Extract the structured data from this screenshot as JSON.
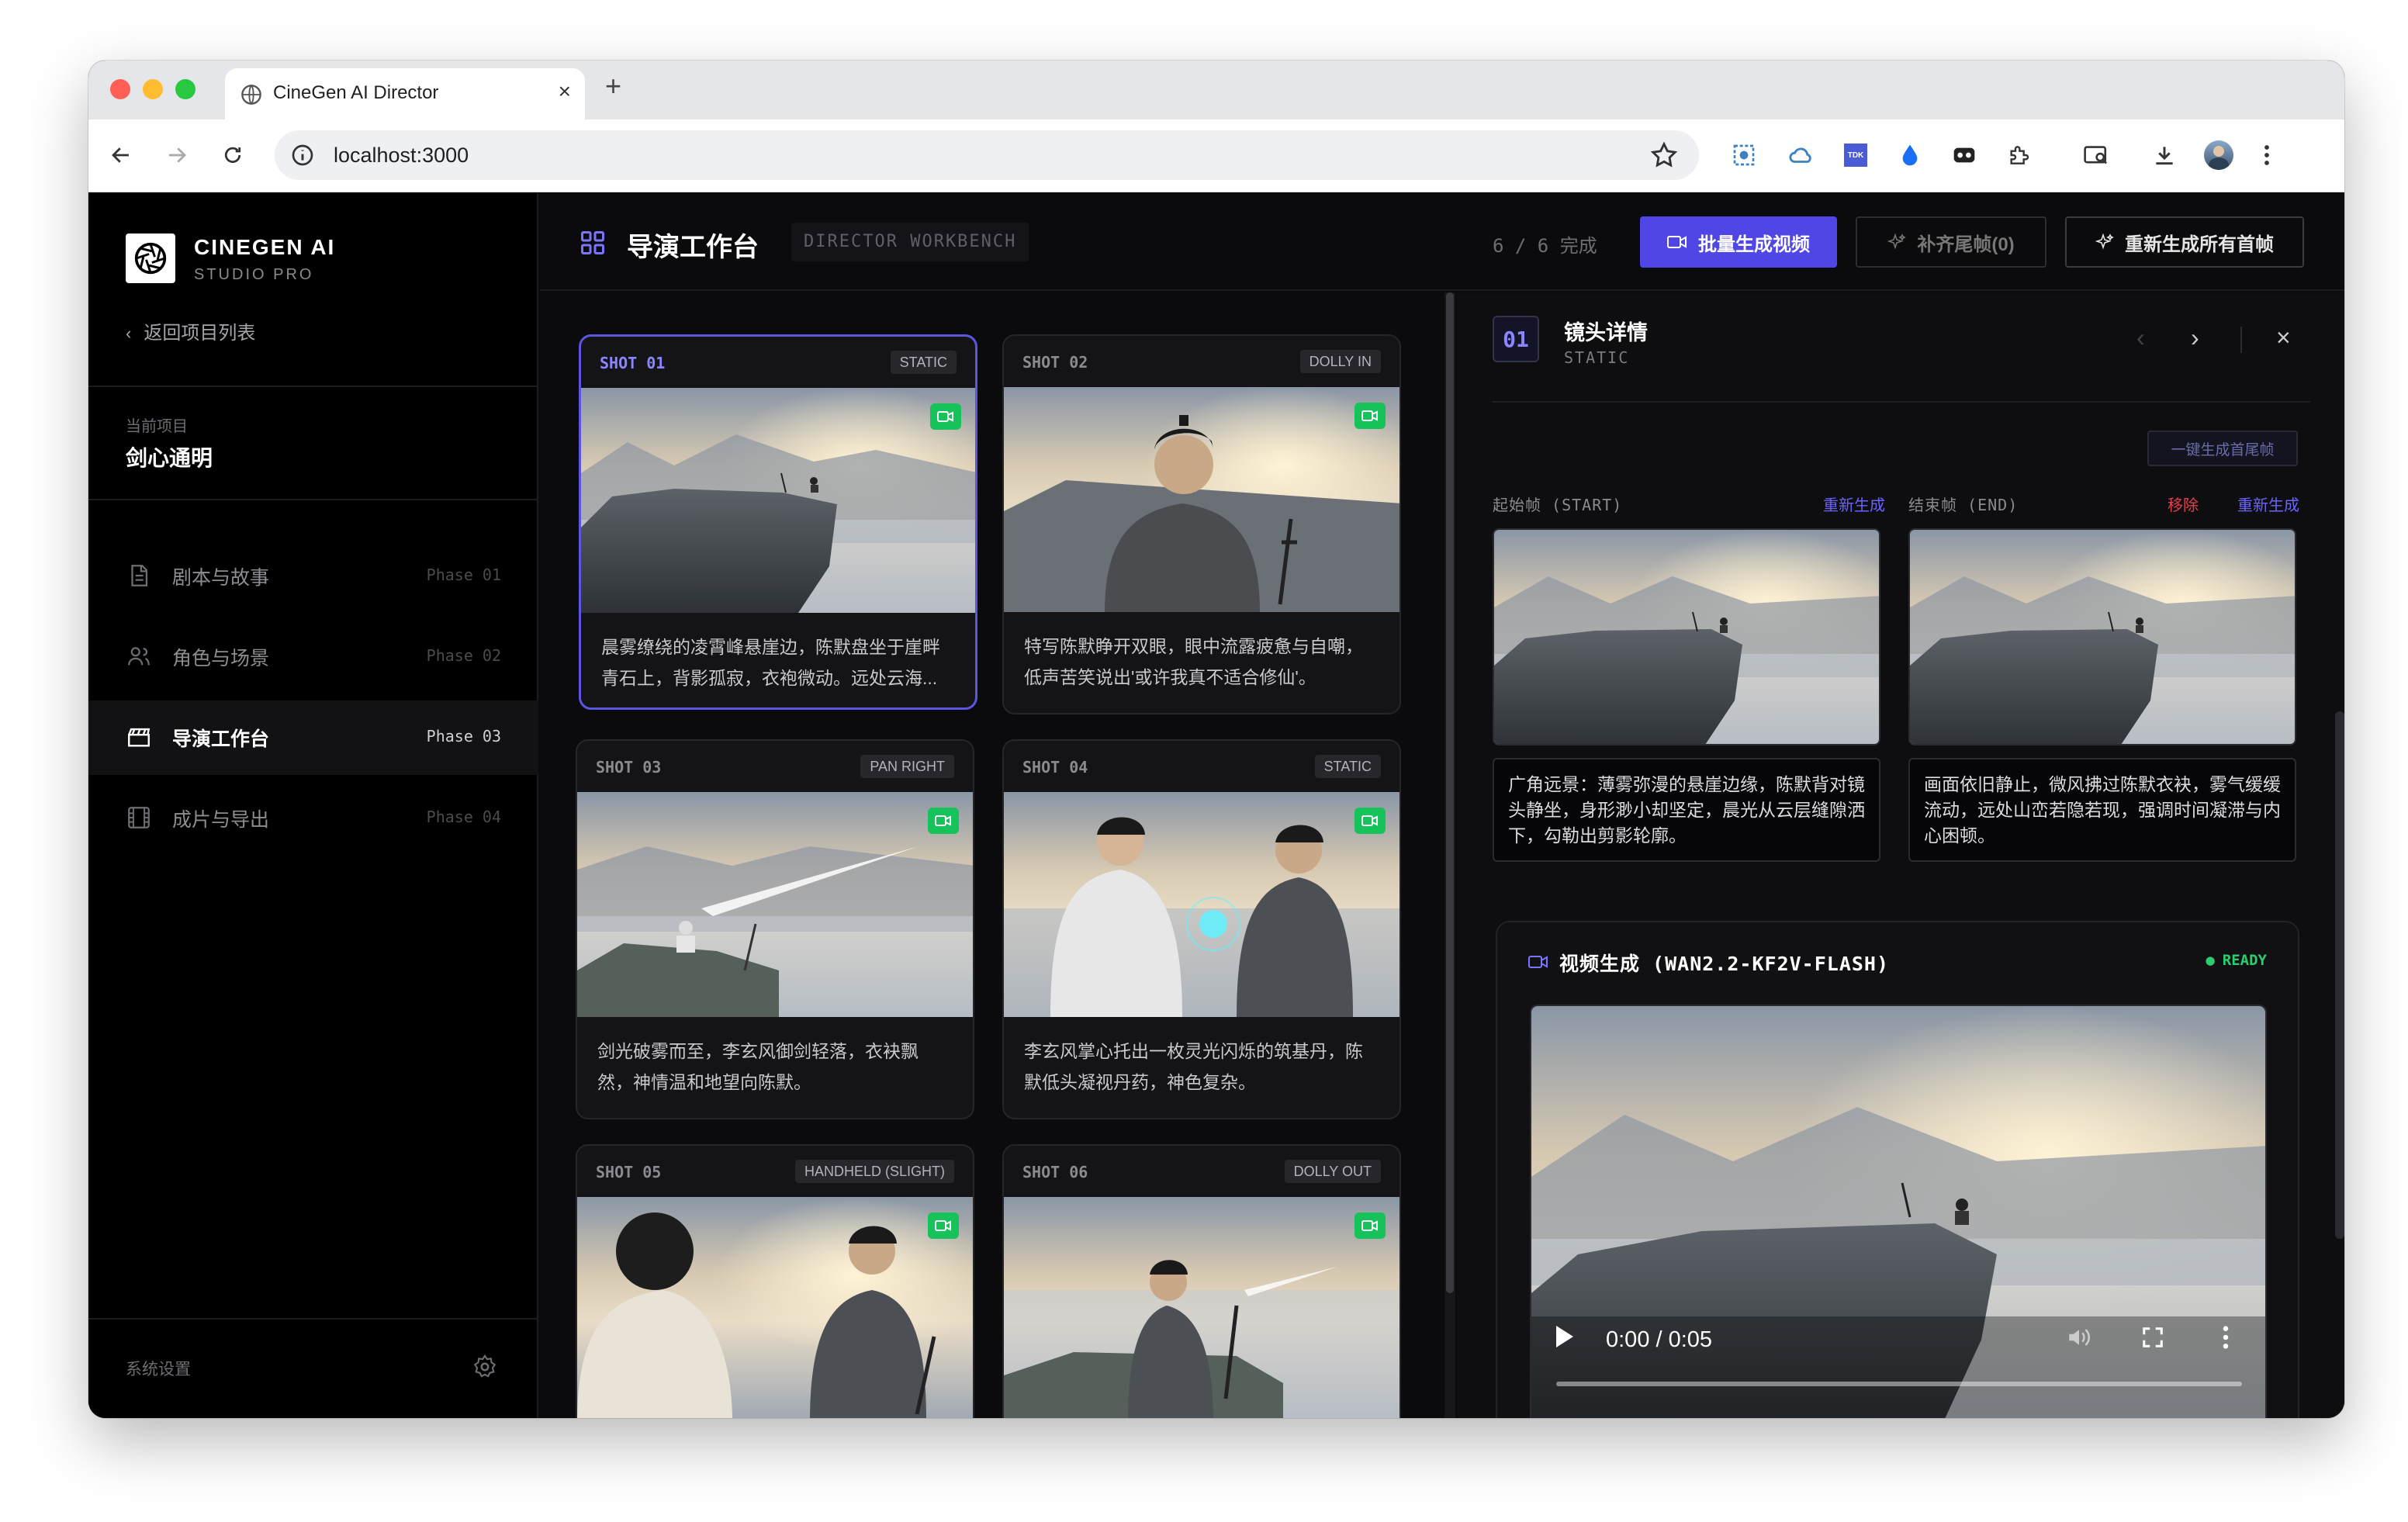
{
  "browser": {
    "tab_title": "CineGen AI Director",
    "url": "localhost:3000"
  },
  "sidebar": {
    "brand": "CINEGEN AI",
    "brand_sub": "STUDIO PRO",
    "back_label": "返回项目列表",
    "project_label": "当前项目",
    "project_name": "剑心通明",
    "items": [
      {
        "label": "剧本与故事",
        "phase": "Phase 01",
        "icon": "document-icon"
      },
      {
        "label": "角色与场景",
        "phase": "Phase 02",
        "icon": "users-icon"
      },
      {
        "label": "导演工作台",
        "phase": "Phase 03",
        "icon": "clapperboard-icon"
      },
      {
        "label": "成片与导出",
        "phase": "Phase 04",
        "icon": "film-icon"
      }
    ],
    "settings_label": "系统设置"
  },
  "header": {
    "title": "导演工作台",
    "subtitle": "DIRECTOR WORKBENCH",
    "progress": "6 / 6 完成",
    "btn_batch_video": "批量生成视频",
    "btn_fill_end": "补齐尾帧(0)",
    "btn_regen_first": "重新生成所有首帧"
  },
  "shots": [
    {
      "id": "SHOT 01",
      "move": "STATIC",
      "desc": "晨雾缭绕的凌霄峰悬崖边，陈默盘坐于崖畔青石上，背影孤寂，衣袍微动。远处云海..."
    },
    {
      "id": "SHOT 02",
      "move": "DOLLY IN",
      "desc": "特写陈默睁开双眼，眼中流露疲惫与自嘲，低声苦笑说出'或许我真不适合修仙'。"
    },
    {
      "id": "SHOT 03",
      "move": "PAN RIGHT",
      "desc": "剑光破雾而至，李玄风御剑轻落，衣袂飘然，神情温和地望向陈默。"
    },
    {
      "id": "SHOT 04",
      "move": "STATIC",
      "desc": "李玄风掌心托出一枚灵光闪烁的筑基丹，陈默低头凝视丹药，神色复杂。"
    },
    {
      "id": "SHOT 05",
      "move": "HANDHELD (SLIGHT)",
      "desc": ""
    },
    {
      "id": "SHOT 06",
      "move": "DOLLY OUT",
      "desc": ""
    }
  ],
  "detail": {
    "number": "01",
    "title": "镜头详情",
    "subtitle": "STATIC",
    "btn_gen_frames": "一键生成首尾帧",
    "start_label": "起始帧 (START)",
    "end_label": "结束帧 (END)",
    "regen": "重新生成",
    "remove": "移除",
    "start_desc": "广角远景：薄雾弥漫的悬崖边缘，陈默背对镜头静坐，身形渺小却坚定，晨光从云层缝隙洒下，勾勒出剪影轮廓。",
    "end_desc": "画面依旧静止，微风拂过陈默衣袂，雾气缓缓流动，远处山峦若隐若现，强调时间凝滞与内心困顿。",
    "video_title": "视频生成 (WAN2.2-KF2V-FLASH)",
    "video_status": "READY",
    "video_time": "0:00 / 0:05"
  },
  "colors": {
    "accent": "#4f46e5",
    "ready": "#2ecc71",
    "camera_badge": "#16c25a",
    "remove": "#e0414a"
  }
}
